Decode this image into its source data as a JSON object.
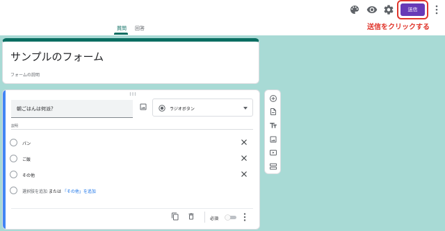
{
  "tabs": [
    {
      "label": "質問",
      "active": true
    },
    {
      "label": "回答",
      "active": false
    }
  ],
  "toolbar": {
    "icons": [
      "palette-icon",
      "eye-icon",
      "gear-icon"
    ],
    "send_label": "送信",
    "more_icon": "more-vert-icon"
  },
  "annotation": "送信をクリックする",
  "form": {
    "title": "サンプルのフォーム",
    "description": "フォームの説明"
  },
  "question": {
    "text": "朝ごはんは何派？",
    "type_label": "ラジオボタン",
    "description_label": "説明",
    "options": [
      {
        "label": "パン"
      },
      {
        "label": "ご飯"
      },
      {
        "label": "その他"
      }
    ],
    "add_option_label": "選択肢を追加",
    "or_label": "または",
    "add_other_label": "「その他」を追加",
    "required_label": "必須",
    "required_on": false
  },
  "side_tools": [
    "add-question-icon",
    "import-icon",
    "title-text-icon",
    "image-icon",
    "video-icon",
    "section-icon"
  ],
  "colors": {
    "background": "#a8dad5",
    "accent": "#0b6e62",
    "send_button": "#673ab7",
    "annotation": "#e0352b",
    "active_question": "#4285f4"
  }
}
